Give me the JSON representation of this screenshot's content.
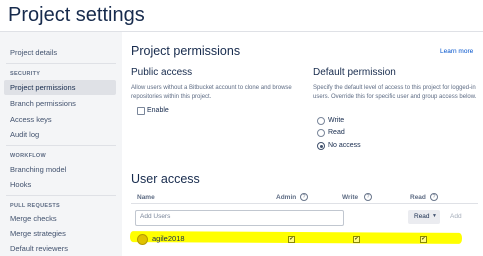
{
  "header": {
    "title": "Project settings"
  },
  "sidebar": {
    "top_items": [
      {
        "label": "Project details"
      }
    ],
    "sections": [
      {
        "title": "SECURITY",
        "items": [
          {
            "label": "Project permissions"
          },
          {
            "label": "Branch permissions"
          },
          {
            "label": "Access keys"
          },
          {
            "label": "Audit log"
          }
        ]
      },
      {
        "title": "WORKFLOW",
        "items": [
          {
            "label": "Branching model"
          },
          {
            "label": "Hooks"
          }
        ]
      },
      {
        "title": "PULL REQUESTS",
        "items": [
          {
            "label": "Merge checks"
          },
          {
            "label": "Merge strategies"
          },
          {
            "label": "Default reviewers"
          }
        ]
      }
    ],
    "active_item": "Project permissions"
  },
  "main": {
    "title": "Project permissions",
    "learn_more": "Learn more",
    "public_access": {
      "title": "Public access",
      "description": "Allow users without a Bitbucket account to clone and browse repositories within this project.",
      "enable_label": "Enable",
      "enabled": false
    },
    "default_permission": {
      "title": "Default permission",
      "description": "Specify the default level of access to this project for logged-in users. Override this for specific user and group access below.",
      "options": [
        {
          "label": "Write"
        },
        {
          "label": "Read"
        },
        {
          "label": "No access"
        }
      ],
      "selected": "No access"
    },
    "user_access": {
      "title": "User access",
      "columns": {
        "name": "Name",
        "admin": "Admin",
        "write": "Write",
        "read": "Read"
      },
      "help_icon": "?",
      "add_users_placeholder": "Add Users",
      "permission_select": "Read",
      "add_button": "Add",
      "rows": [
        {
          "name": "agile2018",
          "admin": true,
          "write": true,
          "read": true
        }
      ]
    }
  },
  "colors": {
    "highlight": "#ffff00",
    "link": "#0052cc",
    "text": "#172b4d",
    "sidebar_bg": "#f4f5f7"
  }
}
